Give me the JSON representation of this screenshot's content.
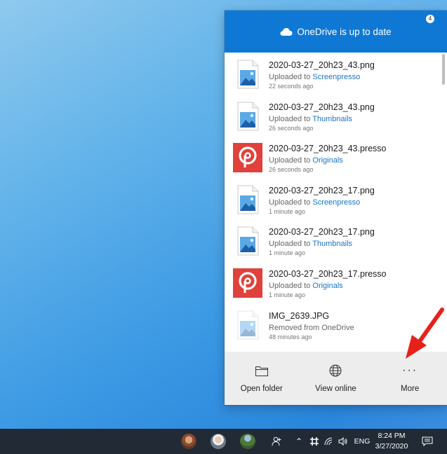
{
  "flyout": {
    "title": "OneDrive is up to date",
    "files": [
      {
        "name": "2020-03-27_20h23_43.png",
        "action": "Uploaded to",
        "folder": "Screenpresso",
        "time": "22 seconds ago",
        "type": "image"
      },
      {
        "name": "2020-03-27_20h23_43.png",
        "action": "Uploaded to",
        "folder": "Thumbnails",
        "time": "26 seconds ago",
        "type": "image"
      },
      {
        "name": "2020-03-27_20h23_43.presso",
        "action": "Uploaded to",
        "folder": "Originals",
        "time": "26 seconds ago",
        "type": "presso"
      },
      {
        "name": "2020-03-27_20h23_17.png",
        "action": "Uploaded to",
        "folder": "Screenpresso",
        "time": "1 minute ago",
        "type": "image"
      },
      {
        "name": "2020-03-27_20h23_17.png",
        "action": "Uploaded to",
        "folder": "Thumbnails",
        "time": "1 minute ago",
        "type": "image"
      },
      {
        "name": "2020-03-27_20h23_17.presso",
        "action": "Uploaded to",
        "folder": "Originals",
        "time": "1 minute ago",
        "type": "presso"
      },
      {
        "name": "IMG_2639.JPG",
        "action": "Removed from OneDrive",
        "folder": "",
        "time": "48 minutes ago",
        "type": "image-faded"
      }
    ],
    "footer": {
      "open_folder": "Open folder",
      "view_online": "View online",
      "more": "More",
      "more_icon": "···"
    },
    "colors": {
      "header": "#0f78d4",
      "link": "#1a73c8",
      "presso": "#e0413b"
    }
  },
  "taskbar": {
    "language": "ENG",
    "time": "8:24 PM",
    "date": "3/27/2020",
    "notification_count": "4"
  },
  "annotation": {
    "arrow_color": "#e8201a"
  }
}
